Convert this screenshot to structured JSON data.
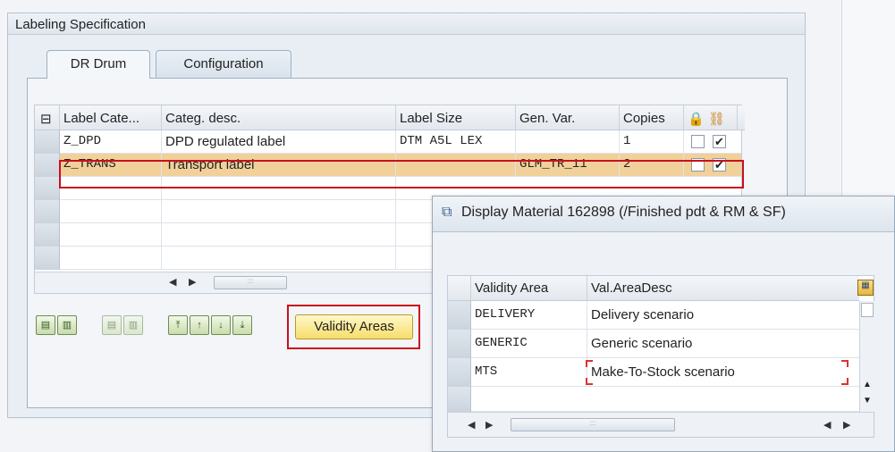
{
  "group_box": {
    "title": "Labeling Specification"
  },
  "tabs": [
    {
      "label": "DR Drum",
      "active": true
    },
    {
      "label": "Configuration",
      "active": false
    }
  ],
  "label_table": {
    "columns": [
      "Label Cate...",
      "Categ. desc.",
      "Label Size",
      "Gen. Var.",
      "Copies"
    ],
    "rows": [
      {
        "category": "Z_DPD",
        "description": "DPD regulated label",
        "size": "DTM A5L LEX",
        "gen_var": "",
        "copies": "1",
        "check1": false,
        "check2": true,
        "selected": false
      },
      {
        "category": "Z_TRANS",
        "description": "Transport label",
        "size": "",
        "gen_var": "GLM_TR_11",
        "copies": "2",
        "check1": false,
        "check2": true,
        "selected": true
      }
    ]
  },
  "toolbar": {
    "validity_button": "Validity Areas"
  },
  "popup": {
    "title": "Display Material 162898 (/Finished pdt & RM & SF)",
    "columns": [
      "Validity Area",
      "Val.AreaDesc"
    ],
    "rows": [
      {
        "area": "DELIVERY",
        "desc": "Delivery scenario"
      },
      {
        "area": "GENERIC",
        "desc": "Generic scenario"
      },
      {
        "area": "MTS",
        "desc": "Make-To-Stock scenario"
      }
    ]
  },
  "colors": {
    "highlight": "#c8101e",
    "selected_row": "#f2d09a",
    "button_yellow": "#f6dd6a"
  }
}
